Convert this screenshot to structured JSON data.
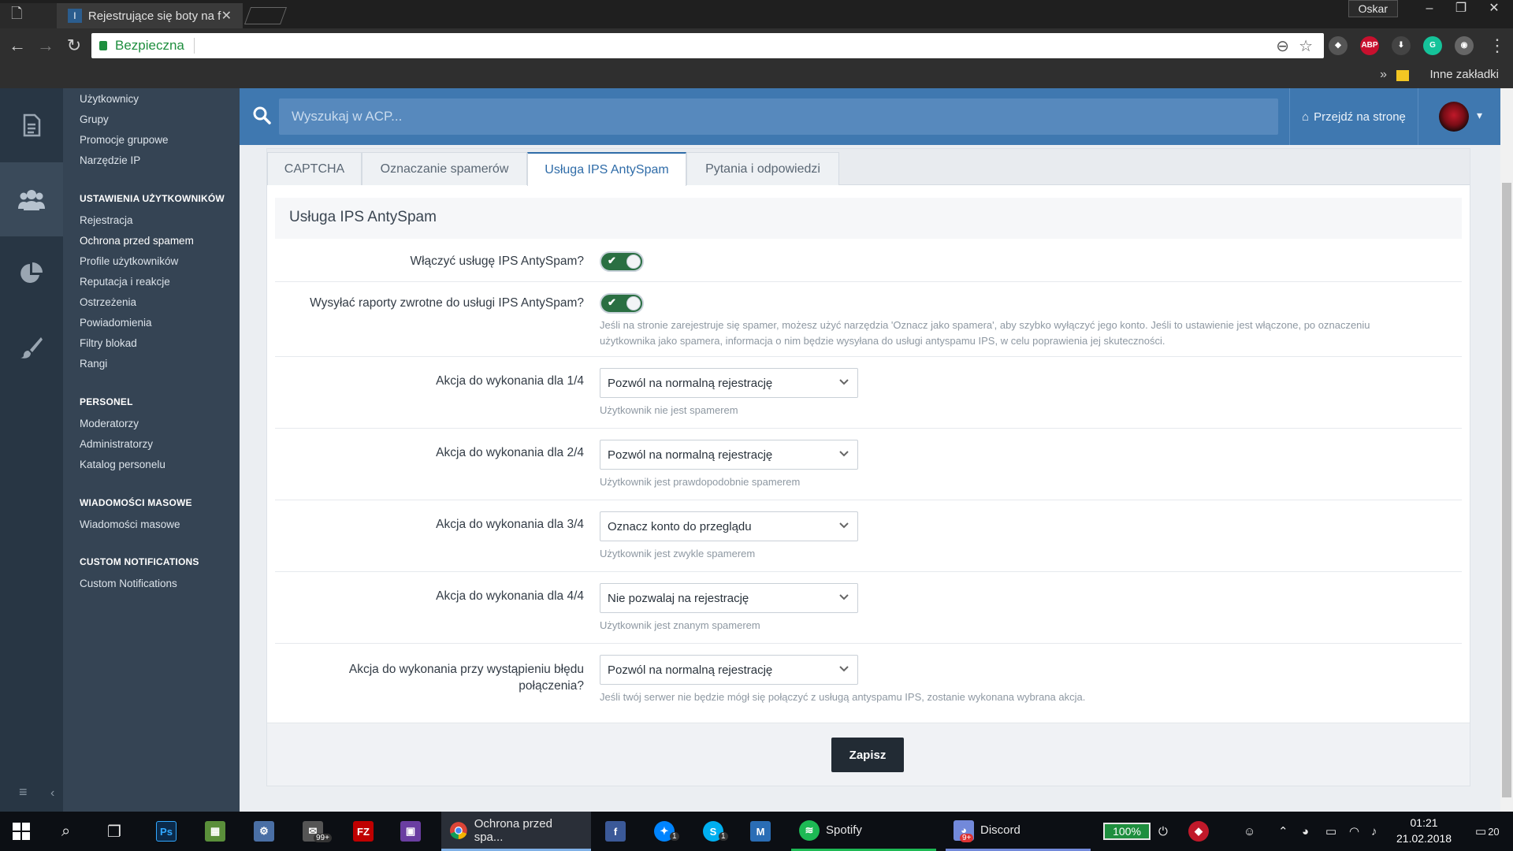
{
  "browser": {
    "tab_title": "Rejestrujące się boty na f",
    "user": "Oskar",
    "secure_label": "Bezpieczna",
    "bookmarks_label": "Inne zakładki",
    "extensions": [
      "ABP",
      "G"
    ]
  },
  "sidebar": {
    "items_top": [
      "Użytkownicy",
      "Grupy",
      "Promocje grupowe",
      "Narzędzie IP"
    ],
    "sections": [
      {
        "head": "USTAWIENIA UŻYTKOWNIKÓW",
        "items": [
          "Rejestracja",
          "Ochrona przed spamem",
          "Profile użytkowników",
          "Reputacja i reakcje",
          "Ostrzeżenia",
          "Powiadomienia",
          "Filtry blokad",
          "Rangi"
        ]
      },
      {
        "head": "PERSONEL",
        "items": [
          "Moderatorzy",
          "Administratorzy",
          "Katalog personelu"
        ]
      },
      {
        "head": "WIADOMOŚCI MASOWE",
        "items": [
          "Wiadomości masowe"
        ]
      },
      {
        "head": "CUSTOM NOTIFICATIONS",
        "items": [
          "Custom Notifications"
        ]
      }
    ]
  },
  "header": {
    "search_placeholder": "Wyszukaj w ACP...",
    "goto_label": "Przejdź na stronę"
  },
  "tabs": [
    "CAPTCHA",
    "Oznaczanie spamerów",
    "Usługa IPS AntySpam",
    "Pytania i odpowiedzi"
  ],
  "active_tab": 2,
  "section_title": "Usługa IPS AntySpam",
  "form": {
    "enable_label": "Włączyć usługę IPS AntySpam?",
    "enable_on": true,
    "report_label": "Wysyłać raporty zwrotne do usługi IPS AntySpam?",
    "report_on": true,
    "report_hint_1": "Jeśli na stronie zarejestruje się spamer, możesz użyć narzędzia 'Oznacz jako spamera', aby szybko wyłączyć jego konto. Jeśli to ustawienie jest włączone, po oznaczeniu",
    "report_hint_2": "użytkownika jako spamera, informacja o nim będzie wysyłana do usługi antyspamu IPS, w celu poprawienia jej skuteczności.",
    "actions": [
      {
        "label": "Akcja do wykonania dla 1/4",
        "value": "Pozwól na normalną rejestrację",
        "hint": "Użytkownik nie jest spamerem"
      },
      {
        "label": "Akcja do wykonania dla 2/4",
        "value": "Pozwól na normalną rejestrację",
        "hint": "Użytkownik jest prawdopodobnie spamerem"
      },
      {
        "label": "Akcja do wykonania dla 3/4",
        "value": "Oznacz konto do przeglądu",
        "hint": "Użytkownik jest zwykle spamerem"
      },
      {
        "label": "Akcja do wykonania dla 4/4",
        "value": "Nie pozwalaj na rejestrację",
        "hint": "Użytkownik jest znanym spamerem"
      }
    ],
    "error_label_1": "Akcja do wykonania przy wystąpieniu błędu",
    "error_label_2": "połączenia?",
    "error_value": "Pozwól na normalną rejestrację",
    "error_hint": "Jeśli twój serwer nie będzie mógł się połączyć z usługą antyspamu IPS, zostanie wykonana wybrana akcja.",
    "save_label": "Zapisz"
  },
  "taskbar": {
    "apps": [
      {
        "label": "Ochrona przed spa..."
      },
      {
        "label": "Spotify"
      },
      {
        "label": "Discord"
      }
    ],
    "badges": [
      "99+",
      "1",
      "1",
      "9+"
    ],
    "battery": "100%",
    "time": "01:21",
    "date": "21.02.2018",
    "notifications": "20"
  },
  "colors": {
    "header_blue": "#3f78b0",
    "sidebar": "#354454",
    "toggle_on": "#2a6f42",
    "save_button": "#222b34"
  }
}
